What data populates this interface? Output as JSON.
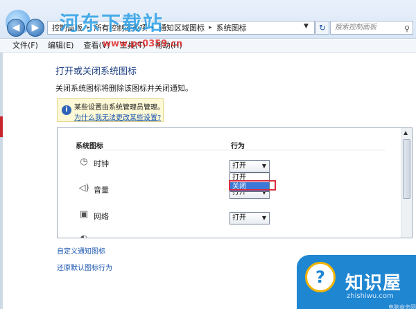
{
  "address": {
    "crumbs": [
      "控制面板",
      "所有控制面板项",
      "通知区域图标",
      "系统图标"
    ],
    "separator": "▸",
    "search_placeholder": "搜索控制面板",
    "back_icon": "back-arrow-icon",
    "forward_icon": "forward-arrow-icon"
  },
  "watermark": {
    "site_title": "河东下载站",
    "site_url": "www.pc0359.cn",
    "brand_title": "知识屋",
    "brand_url": "zhishiwu.com",
    "brand_foot": "电脑商务网"
  },
  "menu": [
    "文件(F)",
    "编辑(E)",
    "查看(V)",
    "工具(T)",
    "帮助(H)"
  ],
  "page": {
    "heading": "打开或关闭系统图标",
    "description": "关闭系统图标将删除该图标并关闭通知。",
    "notice_text": "某些设置由系统管理员管理。",
    "notice_link": "为什么我无法更改某些设置?"
  },
  "table": {
    "col_icon": "系统图标",
    "col_behavior": "行为",
    "rows": [
      {
        "label": "时钟",
        "value": "打开",
        "icon": "clock-icon"
      },
      {
        "label": "音量",
        "value": "打开",
        "icon": "speaker-icon"
      },
      {
        "label": "网络",
        "value": "打开",
        "icon": "network-icon"
      }
    ],
    "dropdown_options": [
      "打开",
      "关闭"
    ],
    "dropdown_selected": "关闭"
  },
  "links": {
    "customize": "自定义通知图标",
    "restore": "还原默认图标行为"
  },
  "colors": {
    "link": "#1a56b0",
    "highlight_box": "#d92d3d",
    "selection": "#3d78d6",
    "heading": "#1c3f80"
  }
}
